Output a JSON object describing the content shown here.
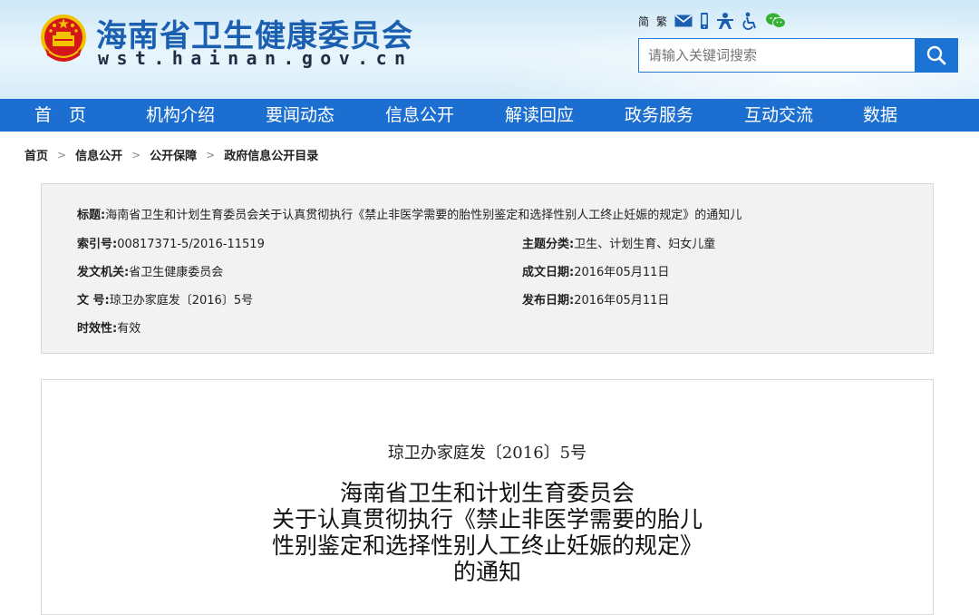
{
  "header": {
    "title": "海南省卫生健康委员会",
    "domain": "wst.hainan.gov.cn",
    "util": {
      "simplified": "简",
      "traditional": "繁"
    },
    "search": {
      "placeholder": "请输入关键词搜索"
    }
  },
  "nav": [
    "首　页",
    "机构介绍",
    "要闻动态",
    "信息公开",
    "解读回应",
    "政务服务",
    "互动交流",
    "数据"
  ],
  "breadcrumb": [
    "首页",
    "信息公开",
    "公开保障",
    "政府信息公开目录"
  ],
  "meta": {
    "title_k": "标题:",
    "title_v": "海南省卫生和计划生育委员会关于认真贯彻执行《禁止非医学需要的胎性别鉴定和选择性别人工终止妊娠的规定》的通知儿",
    "index_k": "索引号:",
    "index_v": "00817371-5/2016-11519",
    "topic_k": "主题分类:",
    "topic_v": "卫生、计划生育、妇女儿童",
    "issuer_k": "发文机关:",
    "issuer_v": "省卫生健康委员会",
    "created_k": "成文日期:",
    "created_v": "2016年05月11日",
    "docno_k": "文 号:",
    "docno_v": "琼卫办家庭发〔2016〕5号",
    "published_k": "发布日期:",
    "published_v": "2016年05月11日",
    "validity_k": "时效性:",
    "validity_v": "有效"
  },
  "doc": {
    "number": "琼卫办家庭发〔2016〕5号",
    "title_lines": [
      "海南省卫生和计划生育委员会",
      "关于认真贯彻执行《禁止非医学需要的胎儿",
      "性别鉴定和选择性别人工终止妊娠的规定》",
      "的通知"
    ]
  },
  "colors": {
    "brand_blue": "#1c6fd0",
    "title_blue": "#1b5fb0",
    "emblem_red": "#d4161b",
    "emblem_gold": "#f2c200"
  },
  "icons": [
    "national-emblem-icon",
    "mail-icon",
    "mobile-icon",
    "accessibility-elder-icon",
    "accessibility-icon",
    "wechat-icon",
    "search-icon"
  ]
}
